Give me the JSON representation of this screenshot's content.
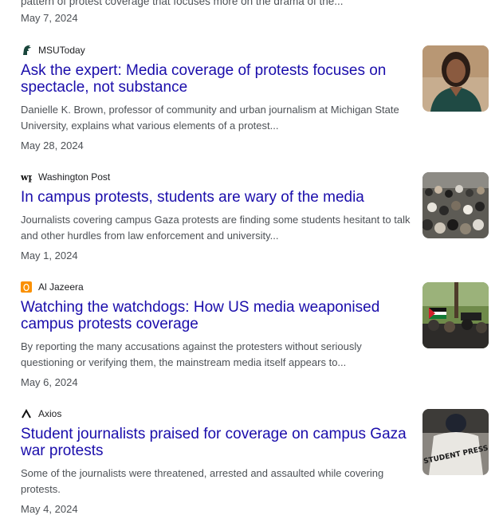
{
  "top": {
    "snippet": "pattern of protest coverage that focuses more on the drama of the...",
    "date": "May 7, 2024"
  },
  "results": [
    {
      "source": "MSUToday",
      "icon": "msu-spartan-icon",
      "title": "Ask the expert: Media coverage of protests focuses on spectacle, not substance",
      "snippet": "Danielle K. Brown, professor of community and urban journalism at Michigan State University, explains what various elements of a protest...",
      "date": "May 28, 2024"
    },
    {
      "source": "Washington Post",
      "icon": "wp-logo-icon",
      "title": "In campus protests, students are wary of the media",
      "snippet": "Journalists covering campus Gaza protests are finding some students hesitant to talk and other hurdles from law enforcement and university...",
      "date": "May 1, 2024"
    },
    {
      "source": "Al Jazeera",
      "icon": "al-jazeera-logo-icon",
      "title": "Watching the watchdogs: How US media weaponised campus protests coverage",
      "snippet": "By reporting the many accusations against the protesters without seriously questioning or verifying them, the mainstream media itself appears to...",
      "date": "May 6, 2024"
    },
    {
      "source": "Axios",
      "icon": "axios-logo-icon",
      "title": "Student journalists praised for coverage on campus Gaza war protests",
      "snippet": "Some of the journalists were threatened, arrested and assaulted while covering protests.",
      "date": "May 4, 2024"
    }
  ],
  "thumb_texts": {
    "press_vest": "STUDENT PRESS"
  },
  "colors": {
    "link": "#1a0dab",
    "snippet": "#4d5156",
    "msu_green": "#18453b",
    "aljazeera_orange": "#fa9000"
  }
}
